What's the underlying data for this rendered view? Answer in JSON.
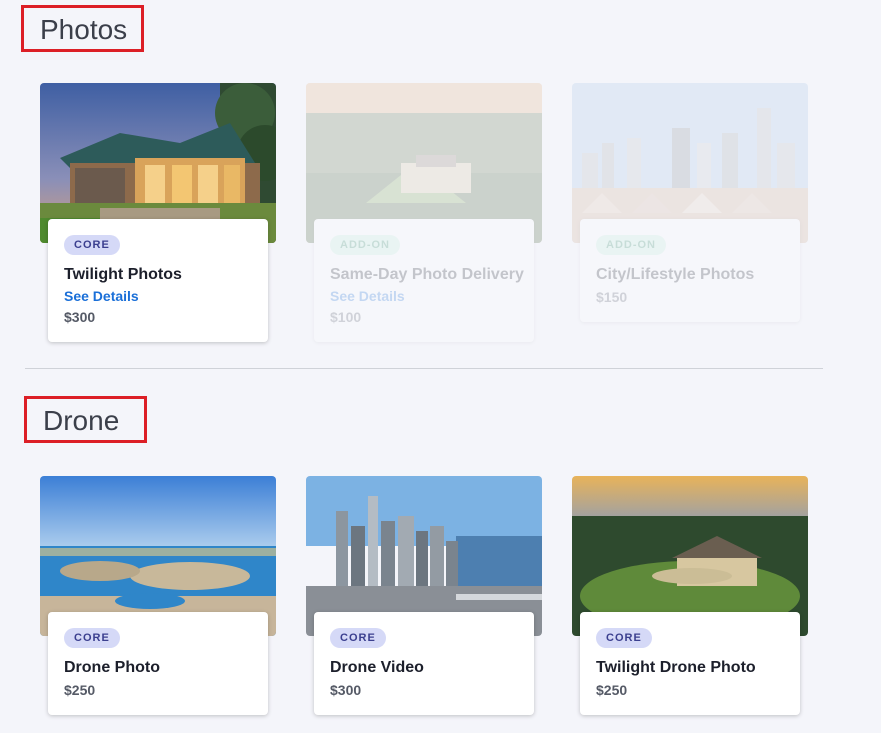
{
  "sections": {
    "photos": {
      "title": "Photos",
      "cards": [
        {
          "badge": "CORE",
          "title": "Twilight Photos",
          "link": "See Details",
          "price": "$300"
        },
        {
          "badge": "ADD-ON",
          "title": "Same-Day Photo Delivery",
          "link": "See Details",
          "price": "$100"
        },
        {
          "badge": "ADD-ON",
          "title": "City/Lifestyle Photos",
          "price": "$150"
        }
      ]
    },
    "drone": {
      "title": "Drone",
      "cards": [
        {
          "badge": "CORE",
          "title": "Drone Photo",
          "price": "$250"
        },
        {
          "badge": "CORE",
          "title": "Drone Video",
          "price": "$300"
        },
        {
          "badge": "CORE",
          "title": "Twilight Drone Photo",
          "price": "$250"
        }
      ]
    }
  },
  "colors": {
    "page_background": "#f4f5fa",
    "highlight_border": "#dc1f26",
    "link": "#1a6fd8",
    "core_badge_bg": "#d5d9f7",
    "addon_badge_bg": "#c6f1de"
  },
  "images": {
    "twilight_photos": "house-at-dusk-image",
    "same_day_delivery": "aerial-estate-image",
    "city_lifestyle": "city-skyline-image",
    "drone_photo": "waterfront-aerial-image",
    "drone_video": "downtown-skyline-aerial-image",
    "twilight_drone_photo": "hilltop-estate-sunset-image"
  }
}
